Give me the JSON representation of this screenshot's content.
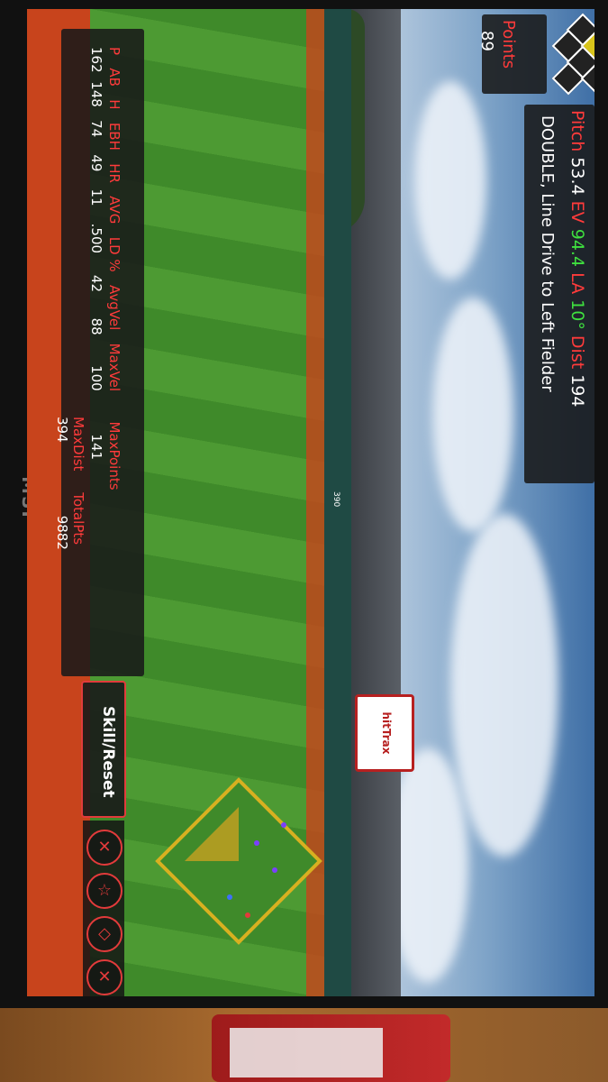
{
  "hud": {
    "points_label": "Points",
    "points_value": "89",
    "pitch": {
      "pitch_label": "Pitch",
      "pitch_value": "53.4",
      "ev_label": "EV",
      "ev_value": "94.4",
      "la_label": "LA",
      "la_value": "10°",
      "dist_label": "Dist",
      "dist_value": "194"
    },
    "result": "DOUBLE, Line Drive to Left Fielder"
  },
  "stats": {
    "rows": [
      {
        "label": "P",
        "value": "162"
      },
      {
        "label": "AB",
        "value": "148"
      },
      {
        "label": "H",
        "value": "74"
      },
      {
        "label": "EBH",
        "value": "49"
      },
      {
        "label": "HR",
        "value": "11"
      },
      {
        "label": "AVG",
        "value": ".500"
      },
      {
        "label": "LD %",
        "value": "42"
      },
      {
        "label": "AvgVel",
        "value": "88"
      },
      {
        "label": "MaxVel",
        "value": "100"
      },
      {
        "label": "MaxDist",
        "value": "394"
      },
      {
        "label": "MaxPoints",
        "value": "141"
      },
      {
        "label": "TotalPts",
        "value": "9882"
      }
    ]
  },
  "controls": {
    "skill_reset_label": "Skill/Reset",
    "icons": [
      "mute-icon",
      "star-icon",
      "diamond-field-icon",
      "close-icon"
    ]
  },
  "scene": {
    "fence_distance": "390",
    "scoreboard_text": "hitTrax"
  },
  "monitor_brand": "MSI",
  "colors": {
    "accent_red": "#ff3b3b",
    "accent_green": "#3fe03f",
    "infield_dirt": "#c8441c",
    "grass": "#4d9a33"
  }
}
